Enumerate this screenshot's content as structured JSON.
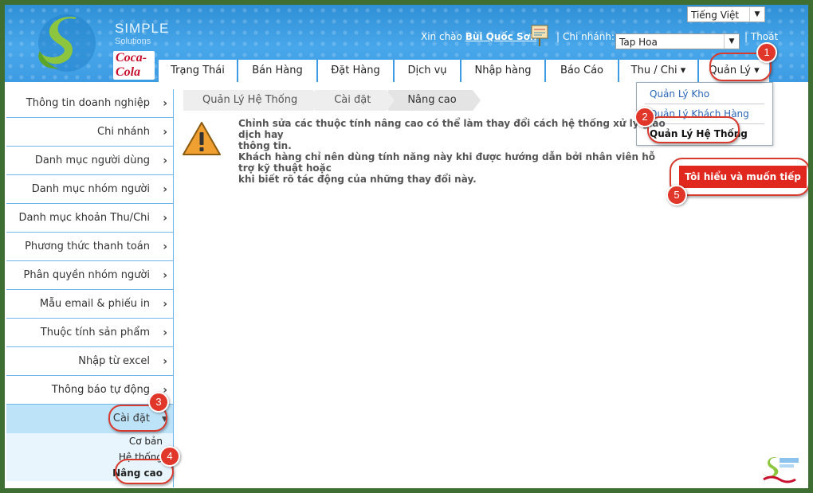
{
  "brand": {
    "name": "SIMPLE",
    "sub": "Solutions",
    "partner": "Coca-Cola"
  },
  "header": {
    "language": "Tiếng Việt",
    "greeting": "Xin chào",
    "user": "Bùi Quốc Sơn",
    "branch_label": "Chi nhánh:",
    "branch_value": "Tap Hoa",
    "logout": "| Thoát",
    "separator": "|"
  },
  "nav": [
    {
      "label": "Trạng Thái"
    },
    {
      "label": "Bán Hàng"
    },
    {
      "label": "Đặt Hàng"
    },
    {
      "label": "Dịch vụ"
    },
    {
      "label": "Nhập hàng"
    },
    {
      "label": "Báo Cáo"
    },
    {
      "label": "Thu / Chi ▾"
    },
    {
      "label": "Quản Lý ▾"
    }
  ],
  "dropdown": [
    {
      "label": "Quản Lý Kho"
    },
    {
      "label": "Quản Lý Khách Hàng"
    },
    {
      "label": "Quản Lý Hệ Thống"
    }
  ],
  "sidebar": [
    {
      "label": "Thông tin doanh nghiệp"
    },
    {
      "label": "Chi nhánh"
    },
    {
      "label": "Danh mục người dùng"
    },
    {
      "label": "Danh mục nhóm người dùng"
    },
    {
      "label": "Danh mục khoản Thu/Chi"
    },
    {
      "label": "Phương thức thanh toán"
    },
    {
      "label": "Phân quyền nhóm người dùng"
    },
    {
      "label": "Mẫu email & phiếu in"
    },
    {
      "label": "Thuộc tính sản phẩm"
    },
    {
      "label": "Nhập từ excel"
    },
    {
      "label": "Thông báo tự động"
    },
    {
      "label": "Cài đặt"
    }
  ],
  "sidebar_sub": [
    {
      "label": "Cơ bản"
    },
    {
      "label": "Hệ thống"
    },
    {
      "label": "Nâng cao"
    }
  ],
  "breadcrumb": [
    {
      "label": "Quản Lý Hệ Thống"
    },
    {
      "label": "Cài đặt"
    },
    {
      "label": "Nâng cao"
    }
  ],
  "warning": {
    "line1": "Chỉnh sửa các thuộc tính nâng cao có thể làm thay đổi cách hệ thống xử lý giao dịch hay",
    "line2": "thông tin.",
    "line3": "Khách hàng chỉ nên dùng tính năng này khi được hướng dẫn bởi nhân viên hỗ trợ kỹ thuật hoặc",
    "line4": "khi biết rõ tác động của những thay đổi này."
  },
  "proceed_button": "Tôi hiểu và muốn tiếp tục",
  "steps": [
    "1",
    "2",
    "3",
    "4",
    "5"
  ],
  "colors": {
    "header": "#3d9be3",
    "accent_red": "#e0281e",
    "sidebar_active": "#bde3f8",
    "link": "#2b66b8"
  }
}
